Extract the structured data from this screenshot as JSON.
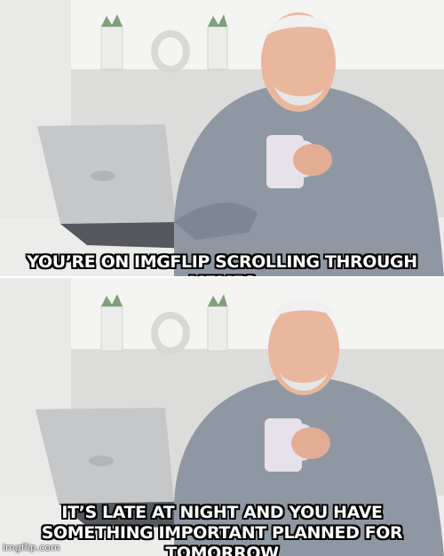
{
  "meme": {
    "top_caption": "YOU’RE ON IMGFLIP SCROLLING THROUGH MEMES",
    "bottom_caption_line1": "IT’S LATE AT NIGHT AND YOU HAVE",
    "bottom_caption_line2": "SOMETHING IMPORTANT PLANNED FOR TOMORROW",
    "watermark": "imgflip.com"
  },
  "colors": {
    "background": "#f2f2f0",
    "shelf": "#d9d9d7",
    "laptop": "#bfc0c2",
    "shirt": "#8d95a0",
    "skin": "#e9b9a0",
    "mug": "#e8e2ec",
    "caption_fill": "#ffffff",
    "caption_stroke": "#000000"
  }
}
